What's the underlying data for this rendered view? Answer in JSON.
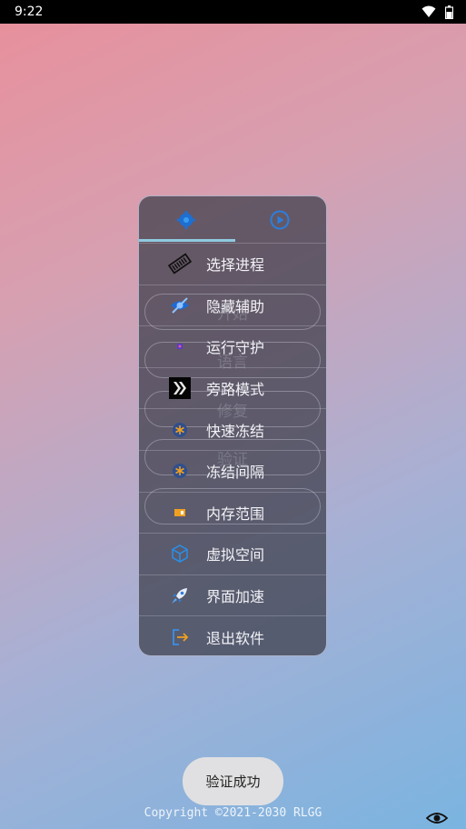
{
  "status_bar": {
    "time": "9:22"
  },
  "panel": {
    "tabs": [
      {
        "icon": "gear-icon"
      },
      {
        "icon": "play-circle-icon"
      }
    ],
    "ghost_buttons": [
      "开始",
      "语言",
      "修复",
      "验证",
      ""
    ],
    "menu_items": [
      {
        "label": "选择进程",
        "icon": "memory-chip-icon"
      },
      {
        "label": "隐藏辅助",
        "icon": "eye-slash-icon"
      },
      {
        "label": "运行守护",
        "icon": "guard-dot-icon"
      },
      {
        "label": "旁路模式",
        "icon": "bypass-chevrons-icon"
      },
      {
        "label": "快速冻结",
        "icon": "freeze-icon"
      },
      {
        "label": "冻结间隔",
        "icon": "freeze-interval-icon"
      },
      {
        "label": "内存范围",
        "icon": "memory-range-icon"
      },
      {
        "label": "虚拟空间",
        "icon": "cube-icon"
      },
      {
        "label": "界面加速",
        "icon": "rocket-icon"
      },
      {
        "label": "退出软件",
        "icon": "exit-icon"
      }
    ]
  },
  "toast": {
    "text": "验证成功"
  },
  "footer": {
    "copyright": "Copyright ©2021-2030 RLGG"
  }
}
